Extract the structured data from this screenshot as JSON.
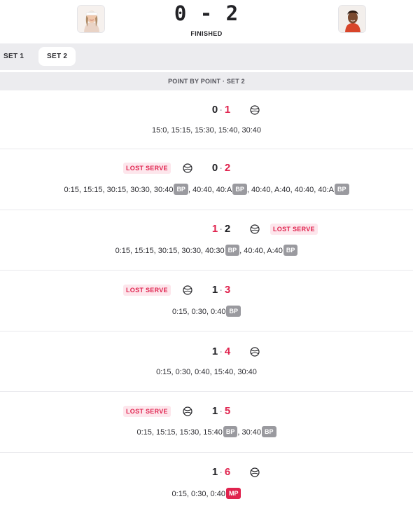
{
  "match": {
    "score": "0 - 2",
    "status": "FINISHED",
    "player_left_avatar": "player-avatar",
    "player_right_avatar": "player-avatar"
  },
  "tabs": [
    {
      "label": "SET 1",
      "selected": false
    },
    {
      "label": "SET 2",
      "selected": true
    }
  ],
  "section_title": "POINT BY POINT · SET 2",
  "games": [
    {
      "score_left": "0",
      "score_right": "1",
      "separator": "·",
      "lost_serve": "",
      "points": "15:0, 15:15, 15:30, 15:40, 30:40",
      "badges": []
    },
    {
      "score_left": "0",
      "score_right": "2",
      "separator": "·",
      "lost_serve": "LOST SERVE",
      "points_parts": [
        "0:15, 15:15, 30:15, 30:30, 30:40",
        ", 40:40, 40:A",
        ", 40:40, A:40, 40:40, 40:A",
        ""
      ],
      "badges": [
        "BP",
        "BP",
        "BP"
      ]
    },
    {
      "score_left": "1",
      "score_right": "2",
      "separator": "·",
      "lost_serve": "LOST SERVE",
      "points_parts": [
        "0:15, 15:15, 30:15, 30:30, 40:30",
        ", 40:40, A:40",
        ""
      ],
      "badges": [
        "BP",
        "BP"
      ]
    },
    {
      "score_left": "1",
      "score_right": "3",
      "separator": "·",
      "lost_serve": "LOST SERVE",
      "points_parts": [
        "0:15, 0:30, 0:40",
        ""
      ],
      "badges": [
        "BP"
      ]
    },
    {
      "score_left": "1",
      "score_right": "4",
      "separator": "·",
      "lost_serve": "",
      "points": "0:15, 0:30, 0:40, 15:40, 30:40",
      "badges": []
    },
    {
      "score_left": "1",
      "score_right": "5",
      "separator": "·",
      "lost_serve": "LOST SERVE",
      "points_parts": [
        "0:15, 15:15, 15:30, 15:40",
        ", 30:40",
        ""
      ],
      "badges": [
        "BP",
        "BP"
      ]
    },
    {
      "score_left": "1",
      "score_right": "6",
      "separator": "·",
      "lost_serve": "",
      "points_parts": [
        "0:15, 0:30, 0:40",
        ""
      ],
      "badges": [
        "MP"
      ]
    }
  ],
  "colors": {
    "accent_red": "#e0234e",
    "lost_serve_bg": "#fde6ec",
    "badge_grey": "#9a9a9f",
    "tab_bar_bg": "#ececef"
  },
  "icons": {
    "serve": "tennis-ball-icon"
  }
}
